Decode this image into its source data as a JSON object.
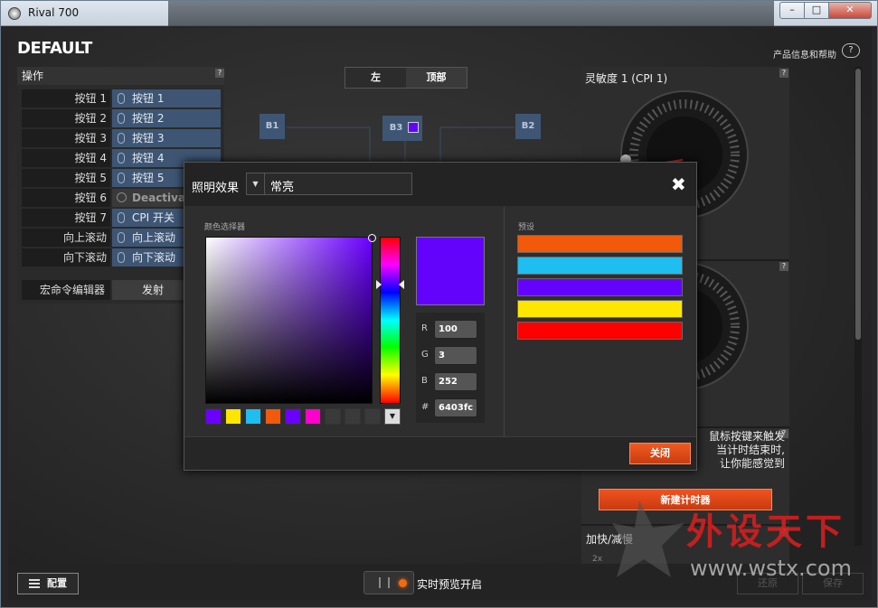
{
  "window": {
    "title": "Rival 700",
    "min": "–",
    "max": "□",
    "close": "✕"
  },
  "header": {
    "profile": "DEFAULT",
    "help_link": "产品信息和帮助",
    "help_icon": "?"
  },
  "actions": {
    "title": "操作",
    "help": "?",
    "rows": [
      {
        "label": "按钮 1",
        "value": "按钮 1"
      },
      {
        "label": "按钮 2",
        "value": "按钮 2"
      },
      {
        "label": "按钮 3",
        "value": "按钮 3"
      },
      {
        "label": "按钮 4",
        "value": "按钮 4"
      },
      {
        "label": "按钮 5",
        "value": "按钮 5"
      },
      {
        "label": "按钮 6",
        "value": "Deactivate"
      },
      {
        "label": "按钮 7",
        "value": "CPI 开关"
      },
      {
        "label": "向上滚动",
        "value": "向上滚动"
      },
      {
        "label": "向下滚动",
        "value": "向下滚动"
      }
    ],
    "macro_label": "宏命令编辑器",
    "macro_value": "发射"
  },
  "view_tabs": {
    "left": "左",
    "top": "顶部"
  },
  "diagram": {
    "b1": "B1",
    "b3": "B3",
    "b2": "B2"
  },
  "right": {
    "sensitivity_label": "灵敏度 1 (CPI 1)",
    "help": "?",
    "timer_text_1": "鼠标按键来触发",
    "timer_text_2": "当计时结束时,",
    "timer_text_3": "让你能感觉到",
    "new_timer": "新建计时器",
    "accel_label": "加快/减慢",
    "accel_scale": "2x"
  },
  "bottom": {
    "config": "配置",
    "live_preview": "实时预览开启",
    "revert": "还原",
    "save": "保存"
  },
  "watermark": {
    "title": "外设天下",
    "url": "www.wstx.com"
  },
  "modal": {
    "effect_label": "照明效果",
    "effect_arrow": "▼",
    "effect_value": "常亮",
    "close_icon": "✖",
    "color_picker_label": "颜色选择器",
    "rgb": {
      "r": "100",
      "g": "3",
      "b": "252",
      "hex": "6403fc"
    },
    "rgb_keys": {
      "r": "R",
      "g": "G",
      "b": "B",
      "hex": "#"
    },
    "recent_colors": [
      "#6a00ff",
      "#ffe600",
      "#1fbdf0",
      "#f05a0a",
      "#6a00ff",
      "#ff00cc",
      "#3a3a3a",
      "#3a3a3a",
      "#3a3a3a"
    ],
    "recent_more": "▼",
    "presets_label": "预设",
    "presets": [
      "#f05a0a",
      "#1fbdf0",
      "#6403fc",
      "#ffe600",
      "#ff0000"
    ],
    "close_button": "关闭",
    "current_color": "#6403fc"
  }
}
